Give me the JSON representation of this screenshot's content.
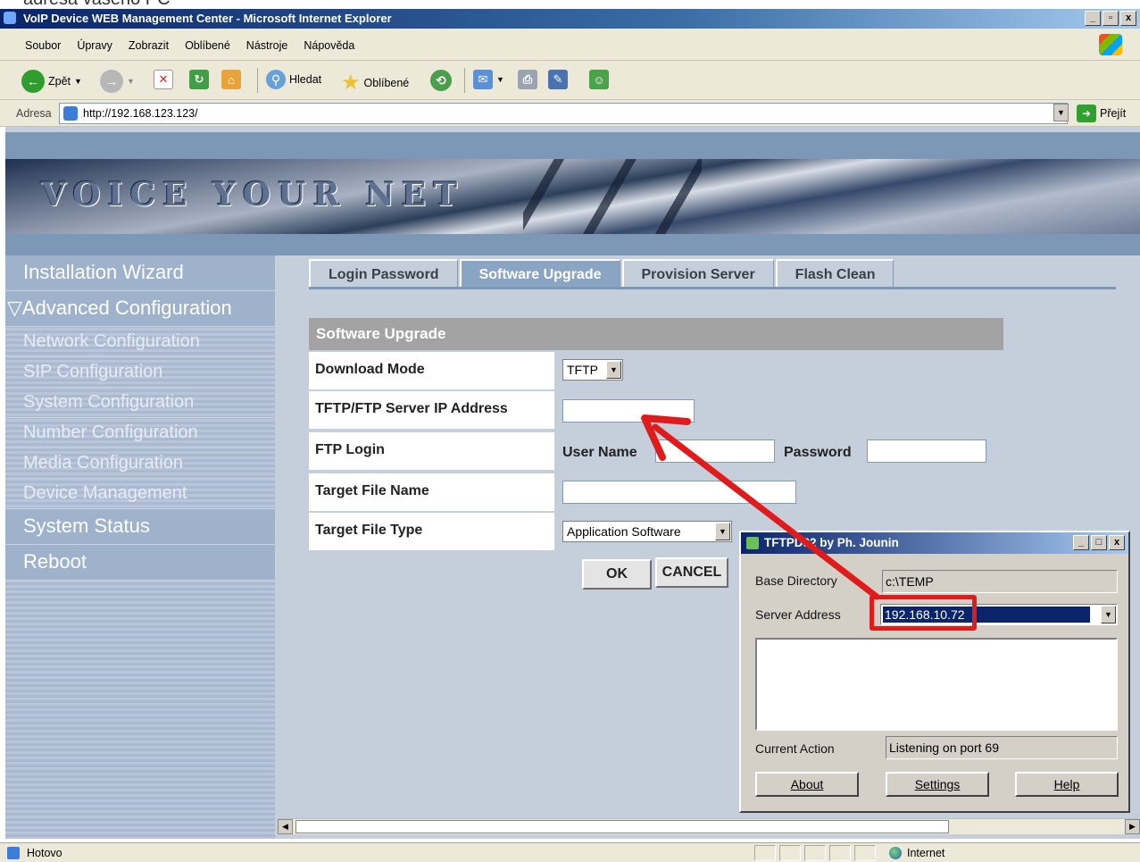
{
  "overlay_text": "adresa vašeho PC",
  "browser": {
    "title": "VoIP Device WEB Management Center - Microsoft Internet Explorer",
    "window_buttons": [
      "_",
      "▫",
      "x"
    ],
    "menu": [
      "Soubor",
      "Úpravy",
      "Zobrazit",
      "Oblíbené",
      "Nástroje",
      "Nápověda"
    ],
    "toolbar": {
      "back": "Zpět",
      "search": "Hledat",
      "favorites": "Oblíbené"
    },
    "address_label": "Adresa",
    "url": "http://192.168.123.123/",
    "go_label": "Přejít",
    "status": "Hotovo",
    "zone": "Internet"
  },
  "site": {
    "logo": "VOICE YOUR NET",
    "sidebar": [
      {
        "label": "Installation Wizard",
        "type": "main"
      },
      {
        "label": "▽Advanced Configuration",
        "type": "main"
      },
      {
        "label": "Network Configuration",
        "type": "sub"
      },
      {
        "label": "SIP Configuration",
        "type": "sub"
      },
      {
        "label": "System Configuration",
        "type": "sub"
      },
      {
        "label": "Number Configuration",
        "type": "sub"
      },
      {
        "label": "Media Configuration",
        "type": "sub"
      },
      {
        "label": "Device Management",
        "type": "sub"
      },
      {
        "label": "System Status",
        "type": "main"
      },
      {
        "label": "Reboot",
        "type": "main"
      }
    ],
    "tabs": [
      "Login Password",
      "Software Upgrade",
      "Provision Server",
      "Flash Clean"
    ],
    "active_tab": "Software Upgrade"
  },
  "form": {
    "title": "Software Upgrade",
    "download_mode_label": "Download Mode",
    "download_mode_value": "TFTP",
    "server_ip_label": "TFTP/FTP Server IP Address",
    "server_ip_value": "",
    "ftp_login_label": "FTP Login",
    "user_name_label": "User Name",
    "password_label": "Password",
    "target_file_name_label": "Target File Name",
    "target_file_type_label": "Target File Type",
    "target_file_type_value": "Application Software",
    "ok_label": "OK",
    "cancel_label": "CANCEL"
  },
  "tftpd": {
    "title": "TFTPD32 by Ph. Jounin",
    "base_directory_label": "Base Directory",
    "base_directory_value": "c:\\TEMP",
    "server_address_label": "Server Address",
    "server_address_value": "192.168.10.72",
    "current_action_label": "Current Action",
    "current_action_value": "Listening on port 69",
    "buttons": [
      "About",
      "Settings",
      "Help"
    ]
  },
  "colors": {
    "annotation": "#e01b1b",
    "active_tab": "#8aa4c4",
    "sidebar": "#aab9cf"
  }
}
